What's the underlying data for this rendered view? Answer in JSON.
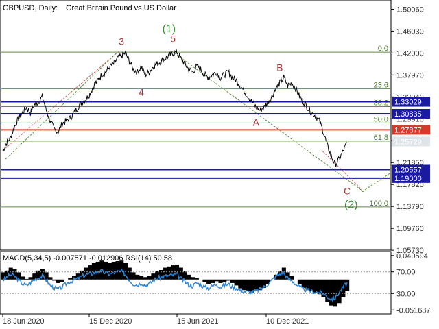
{
  "header": {
    "symbol": "GBPUSD, Daily:",
    "description": "Great Britain Pound vs US Dollar"
  },
  "indicator_header": "MACD(5,34,5) -0.007571 -0.012906 RSI(14) 50.58",
  "colors": {
    "price": "#000000",
    "fib_line": "#5a8f3a",
    "support_resistance": "#1a1aa0",
    "highlight": "#d63a2a",
    "macd_hist": "#000000",
    "rsi": "#2f86d6",
    "wave_red": "#a33333",
    "wave_green": "#3c8c3c"
  },
  "chart_data": [
    {
      "type": "line",
      "title": "",
      "ylim": [
        1.06,
        1.515
      ],
      "ticks": [
        "1.50060",
        "1.46030",
        "1.42000",
        "1.37970",
        "1.33940",
        "1.29910",
        "1.25880",
        "1.21850",
        "1.17820",
        "1.13790",
        "1.09760",
        "1.05730"
      ],
      "x_labels": [
        "18 Jun 2020",
        "15 Dec 2020",
        "15 Jun 2021",
        "10 Dec 2021"
      ],
      "series": [
        {
          "values": [
            1.24,
            1.255,
            1.265,
            1.285,
            1.3,
            1.31,
            1.32,
            1.31,
            1.325,
            1.33,
            1.34,
            1.315,
            1.295,
            1.28,
            1.275,
            1.29,
            1.295,
            1.3,
            1.31,
            1.32,
            1.33,
            1.335,
            1.345,
            1.36,
            1.37,
            1.38,
            1.385,
            1.395,
            1.4,
            1.41,
            1.415,
            1.42,
            1.405,
            1.39,
            1.385,
            1.395,
            1.38,
            1.385,
            1.395,
            1.4,
            1.405,
            1.41,
            1.415,
            1.42,
            1.422,
            1.41,
            1.4,
            1.39,
            1.385,
            1.395,
            1.39,
            1.38,
            1.375,
            1.38,
            1.385,
            1.375,
            1.38,
            1.385,
            1.375,
            1.37,
            1.36,
            1.35,
            1.34,
            1.33,
            1.32,
            1.315,
            1.32,
            1.33,
            1.34,
            1.355,
            1.365,
            1.375,
            1.36,
            1.365,
            1.355,
            1.34,
            1.33,
            1.32,
            1.31,
            1.305,
            1.295,
            1.275,
            1.25,
            1.23,
            1.215,
            1.225,
            1.24,
            1.255
          ]
        }
      ],
      "levels": [
        {
          "value": 1.33029,
          "label": "1.33029",
          "kind": "support_resistance"
        },
        {
          "value": 1.30835,
          "label": "1.30835",
          "kind": "support_resistance"
        },
        {
          "value": 1.27877,
          "label": "1.27877",
          "kind": "highlight"
        },
        {
          "value": 1.25729,
          "label": "1.25729",
          "kind": "current"
        },
        {
          "value": 1.20557,
          "label": "1.20557",
          "kind": "support_resistance"
        },
        {
          "value": 1.19,
          "label": "1.19000",
          "kind": "support_resistance"
        }
      ],
      "fibonacci": [
        {
          "value": 1.4215,
          "label": "0.0"
        },
        {
          "value": 1.3545,
          "label": "23.6"
        },
        {
          "value": 1.3215,
          "label": "38.2"
        },
        {
          "value": 1.2915,
          "label": "50.0"
        },
        {
          "value": 1.258,
          "label": "61.8"
        },
        {
          "value": 1.137,
          "label": "100.0"
        }
      ],
      "wave_labels": [
        {
          "text": "3",
          "x_index": 30,
          "y": 1.435,
          "color": "red"
        },
        {
          "text": "(1)",
          "x_index": 42,
          "y": 1.458,
          "color": "green"
        },
        {
          "text": "5",
          "x_index": 43,
          "y": 1.44,
          "color": "red"
        },
        {
          "text": "4",
          "x_index": 35,
          "y": 1.342,
          "color": "red"
        },
        {
          "text": "B",
          "x_index": 70,
          "y": 1.387,
          "color": "red"
        },
        {
          "text": "A",
          "x_index": 64,
          "y": 1.286,
          "color": "red"
        },
        {
          "text": "C",
          "x_index": 87,
          "y": 1.16,
          "color": "red"
        },
        {
          "text": "(2)",
          "x_index": 88,
          "y": 1.135,
          "color": "green"
        }
      ]
    },
    {
      "type": "bar",
      "title": "",
      "ylim": [
        -0.056,
        0.045
      ],
      "ticks": [
        "0.040594",
        "70.00",
        "30.00",
        "-0.051687"
      ],
      "series": [
        {
          "name": "MACD",
          "values": [
            0.012,
            0.015,
            0.02,
            0.018,
            0.012,
            0.005,
            0.001,
            0.004,
            0.01,
            0.015,
            0.018,
            0.012,
            0.004,
            -0.002,
            -0.006,
            -0.004,
            0.0,
            0.003,
            0.006,
            0.01,
            0.015,
            0.02,
            0.024,
            0.028,
            0.03,
            0.032,
            0.03,
            0.028,
            0.03,
            0.031,
            0.032,
            0.028,
            0.02,
            0.012,
            0.008,
            0.006,
            0.004,
            0.006,
            0.01,
            0.014,
            0.016,
            0.02,
            0.022,
            0.024,
            0.025,
            0.02,
            0.014,
            0.008,
            0.004,
            0.002,
            0.0,
            -0.004,
            -0.008,
            -0.006,
            -0.003,
            -0.006,
            -0.004,
            -0.002,
            -0.006,
            -0.01,
            -0.015,
            -0.018,
            -0.02,
            -0.022,
            -0.02,
            -0.018,
            -0.014,
            -0.008,
            0.0,
            0.008,
            0.014,
            0.02,
            0.012,
            0.006,
            0.0,
            -0.008,
            -0.014,
            -0.018,
            -0.02,
            -0.022,
            -0.025,
            -0.03,
            -0.038,
            -0.044,
            -0.046,
            -0.04,
            -0.03,
            -0.02
          ]
        },
        {
          "name": "RSI",
          "values": [
            55,
            60,
            65,
            62,
            55,
            48,
            45,
            50,
            56,
            60,
            62,
            55,
            45,
            40,
            38,
            42,
            48,
            52,
            55,
            58,
            62,
            65,
            66,
            68,
            70,
            71,
            68,
            66,
            68,
            70,
            71,
            65,
            55,
            48,
            46,
            50,
            45,
            48,
            54,
            58,
            60,
            62,
            63,
            64,
            65,
            58,
            52,
            46,
            44,
            50,
            46,
            42,
            40,
            44,
            48,
            42,
            45,
            48,
            42,
            40,
            36,
            34,
            33,
            32,
            35,
            38,
            42,
            48,
            55,
            62,
            66,
            68,
            58,
            54,
            48,
            42,
            38,
            36,
            34,
            33,
            32,
            30,
            24,
            20,
            22,
            32,
            42,
            50.58
          ]
        }
      ]
    }
  ]
}
